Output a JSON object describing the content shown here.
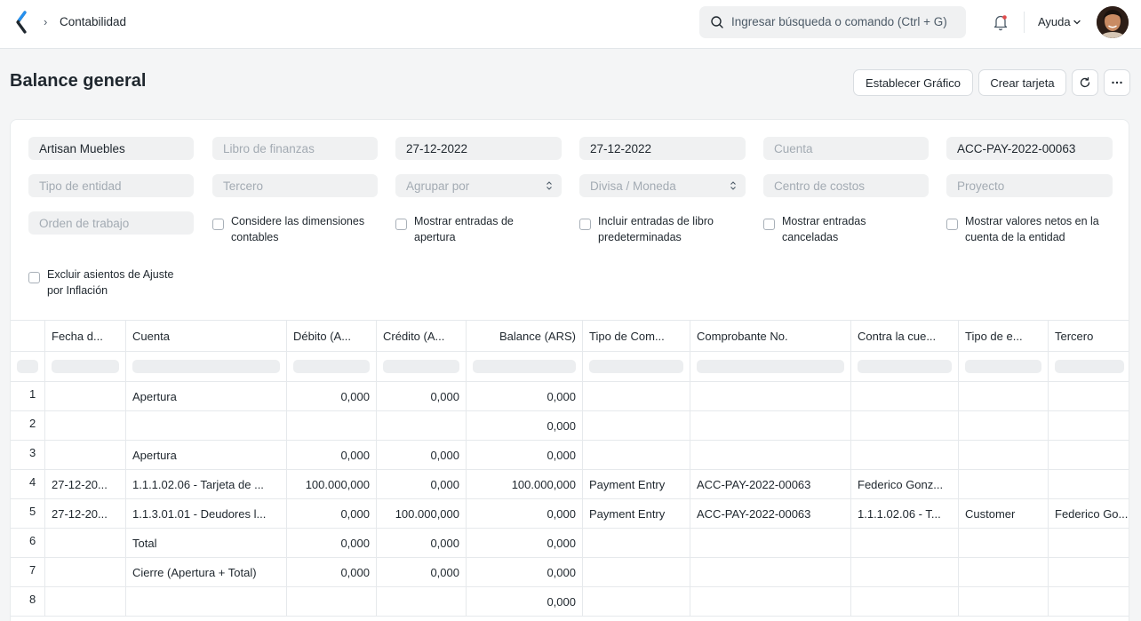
{
  "navbar": {
    "breadcrumb": "Contabilidad",
    "search_placeholder": "Ingresar búsqueda o comando (Ctrl + G)",
    "help_label": "Ayuda"
  },
  "page": {
    "title": "Balance general",
    "buttons": {
      "set_chart": "Establecer Gráfico",
      "create_card": "Crear tarjeta"
    }
  },
  "filters": {
    "company": "Artisan Muebles",
    "finance_book": "Libro de finanzas",
    "from_date": "27-12-2022",
    "to_date": "27-12-2022",
    "account": "Cuenta",
    "voucher_no": "ACC-PAY-2022-00063",
    "party_type": "Tipo de entidad",
    "party": "Tercero",
    "group_by": "Agrupar por",
    "currency": "Divisa / Moneda",
    "cost_center": "Centro de costos",
    "project": "Proyecto",
    "work_order": "Orden de trabajo",
    "checkboxes": {
      "dimensions": "Considere las dimensiones contables",
      "opening": "Mostrar entradas de apertura",
      "default_book": "Incluir entradas de libro predeterminadas",
      "cancelled": "Mostrar entradas canceladas",
      "net_values": "Mostrar valores netos en la cuenta de la entidad",
      "inflation": "Excluir asientos de Ajuste por Inflación"
    }
  },
  "table": {
    "columns": [
      "Fecha d...",
      "Cuenta",
      "Débito (A...",
      "Crédito (A...",
      "Balance (ARS)",
      "Tipo de Com...",
      "Comprobante No.",
      "Contra la cue...",
      "Tipo de e...",
      "Tercero"
    ],
    "rows": [
      {
        "n": "1",
        "date": "",
        "account": "Apertura",
        "debit": "0,000",
        "credit": "0,000",
        "balance": "0,000",
        "vtype": "",
        "vno": "",
        "against": "",
        "ptype": "",
        "party": ""
      },
      {
        "n": "2",
        "date": "",
        "account": "",
        "debit": "",
        "credit": "",
        "balance": "0,000",
        "vtype": "",
        "vno": "",
        "against": "",
        "ptype": "",
        "party": ""
      },
      {
        "n": "3",
        "date": "",
        "account": "Apertura",
        "debit": "0,000",
        "credit": "0,000",
        "balance": "0,000",
        "vtype": "",
        "vno": "",
        "against": "",
        "ptype": "",
        "party": ""
      },
      {
        "n": "4",
        "date": "27-12-20...",
        "account": "1.1.1.02.06 - Tarjeta de ...",
        "debit": "100.000,000",
        "credit": "0,000",
        "balance": "100.000,000",
        "vtype": "Payment Entry",
        "vno": "ACC-PAY-2022-00063",
        "against": "Federico Gonz...",
        "ptype": "",
        "party": ""
      },
      {
        "n": "5",
        "date": "27-12-20...",
        "account": "1.1.3.01.01 - Deudores l...",
        "debit": "0,000",
        "credit": "100.000,000",
        "balance": "0,000",
        "vtype": "Payment Entry",
        "vno": "ACC-PAY-2022-00063",
        "against": "1.1.1.02.06 - T...",
        "ptype": "Customer",
        "party": "Federico Go..."
      },
      {
        "n": "6",
        "date": "",
        "account": "Total",
        "debit": "0,000",
        "credit": "0,000",
        "balance": "0,000",
        "vtype": "",
        "vno": "",
        "against": "",
        "ptype": "",
        "party": ""
      },
      {
        "n": "7",
        "date": "",
        "account": "Cierre (Apertura + Total)",
        "debit": "0,000",
        "credit": "0,000",
        "balance": "0,000",
        "vtype": "",
        "vno": "",
        "against": "",
        "ptype": "",
        "party": ""
      },
      {
        "n": "8",
        "date": "",
        "account": "",
        "debit": "",
        "credit": "",
        "balance": "0,000",
        "vtype": "",
        "vno": "",
        "against": "",
        "ptype": "",
        "party": ""
      }
    ]
  }
}
